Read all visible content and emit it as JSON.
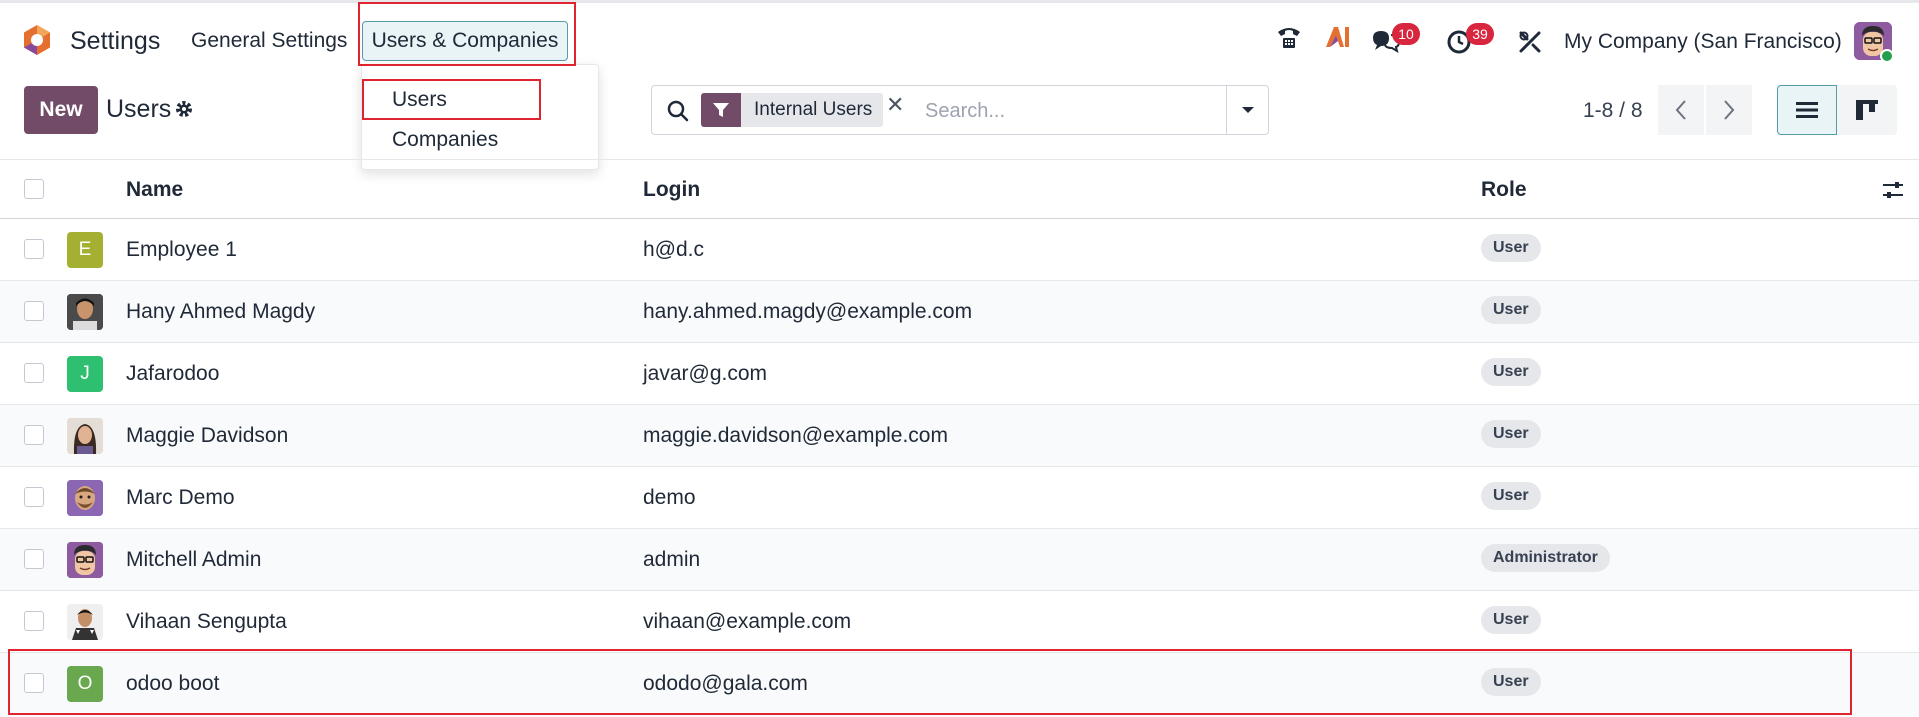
{
  "app": {
    "title": "Settings"
  },
  "menu": {
    "general": "General Settings",
    "users_companies": "Users & Companies"
  },
  "dropdown": {
    "items": [
      "Users",
      "Companies"
    ]
  },
  "systray": {
    "messages_count": "10",
    "activities_count": "39",
    "company": "My Company (San Francisco)"
  },
  "control": {
    "new_label": "New",
    "title": "Users",
    "facet": "Internal Users",
    "search_placeholder": "Search...",
    "pager": "1-8 / 8"
  },
  "table": {
    "headers": {
      "name": "Name",
      "login": "Login",
      "role": "Role"
    },
    "rows": [
      {
        "initial": "E",
        "avatar_color": "#a3b031",
        "name": "Employee 1",
        "login": "h@d.c",
        "role": "User"
      },
      {
        "initial": "",
        "avatar_color": "#3c3c3c",
        "name": "Hany Ahmed Magdy",
        "login": "hany.ahmed.magdy@example.com",
        "role": "User"
      },
      {
        "initial": "J",
        "avatar_color": "#2fbf71",
        "name": "Jafarodoo",
        "login": "javar@g.com",
        "role": "User"
      },
      {
        "initial": "",
        "avatar_color": "#8a6b5a",
        "name": "Maggie Davidson",
        "login": "maggie.davidson@example.com",
        "role": "User"
      },
      {
        "initial": "",
        "avatar_color": "#8a66b3",
        "name": "Marc Demo",
        "login": "demo",
        "role": "User"
      },
      {
        "initial": "",
        "avatar_color": "#7b4b8a",
        "name": "Mitchell Admin",
        "login": "admin",
        "role": "Administrator"
      },
      {
        "initial": "",
        "avatar_color": "#555555",
        "name": "Vihaan Sengupta",
        "login": "vihaan@example.com",
        "role": "User"
      },
      {
        "initial": "O",
        "avatar_color": "#6aa84f",
        "name": "odoo boot",
        "login": "ododo@gala.com",
        "role": "User"
      }
    ]
  },
  "colors": {
    "brand": "#714b67",
    "highlight": "#e0242f",
    "badge": "#d7263d",
    "active": "#e8f4f6"
  }
}
